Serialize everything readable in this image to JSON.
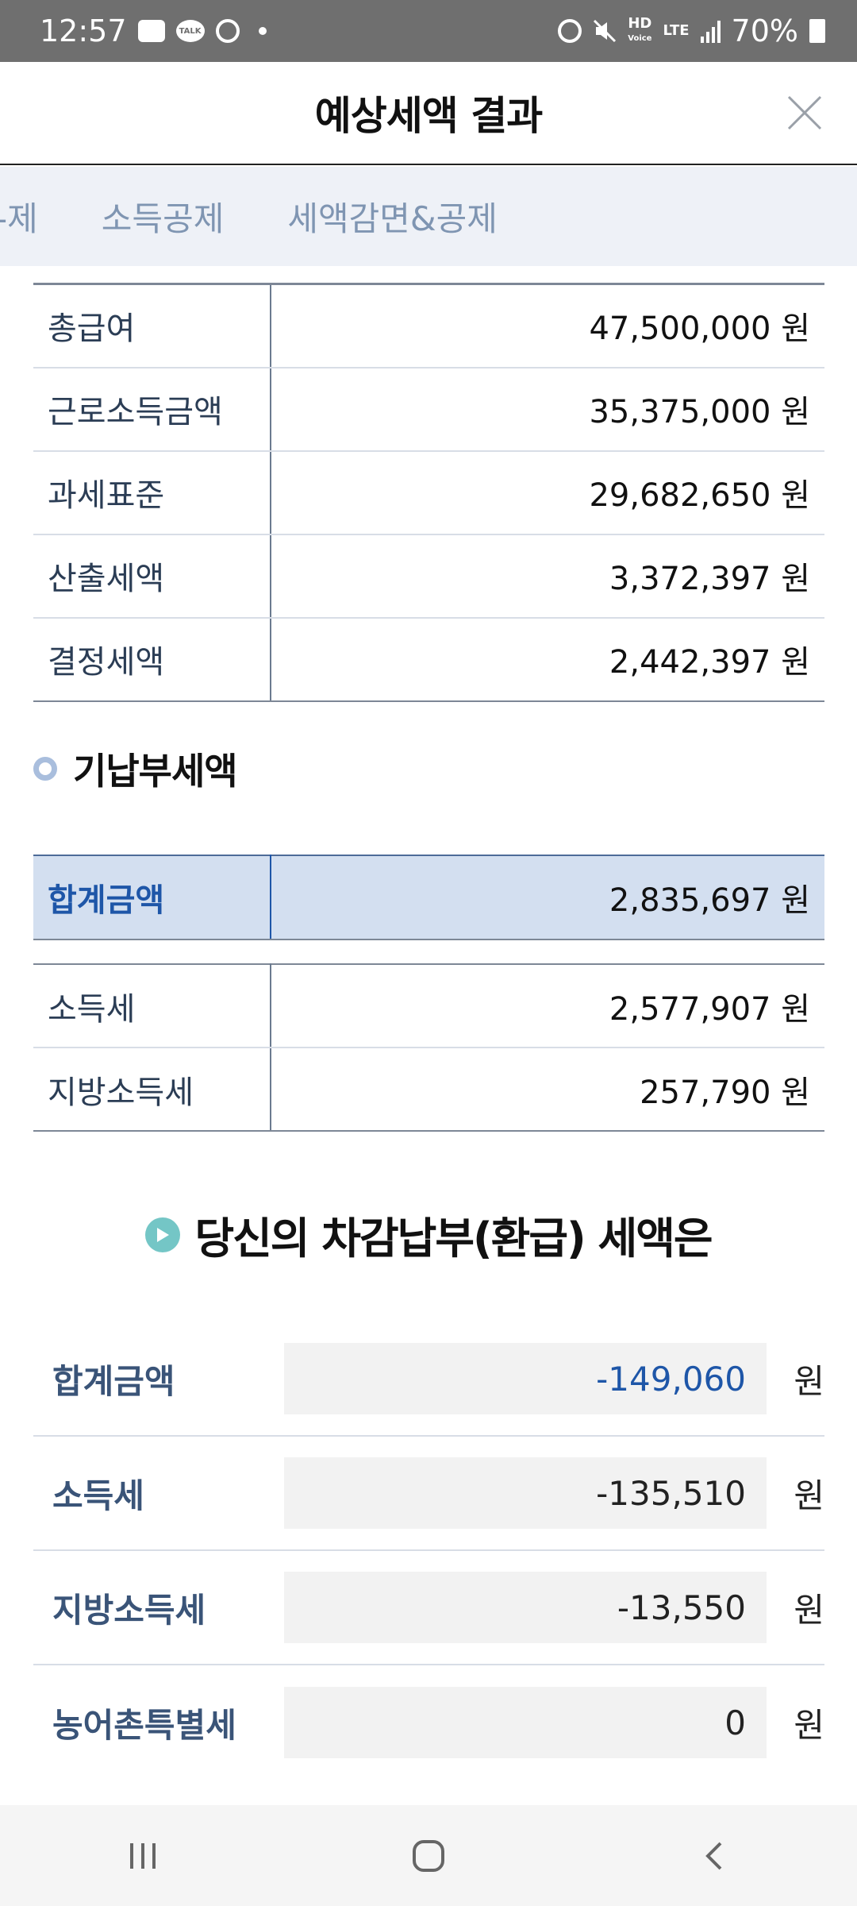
{
  "status_bar": {
    "time": "12:57",
    "talk_label": "TALK",
    "hd_label": "HD",
    "voice_label": "Voice",
    "lte_label": "LTE",
    "battery": "70%"
  },
  "header": {
    "title": "예상세액 결과"
  },
  "tabs": [
    {
      "label": "-제"
    },
    {
      "label": "소득공제"
    },
    {
      "label": "세액감면&공제"
    }
  ],
  "summary_table": [
    {
      "label": "총급여",
      "value": "47,500,000 원"
    },
    {
      "label": "근로소득금액",
      "value": "35,375,000 원"
    },
    {
      "label": "과세표준",
      "value": "29,682,650 원"
    },
    {
      "label": "산출세액",
      "value": "3,372,397 원"
    },
    {
      "label": "결정세액",
      "value": "2,442,397 원"
    }
  ],
  "prepaid": {
    "section_title": "기납부세액",
    "total": {
      "label": "합계금액",
      "value": "2,835,697 원"
    },
    "rows": [
      {
        "label": "소득세",
        "value": "2,577,907 원"
      },
      {
        "label": "지방소득세",
        "value": "257,790 원"
      }
    ]
  },
  "result": {
    "title": "당신의 차감납부(환급) 세액은",
    "unit": "원",
    "rows": [
      {
        "label": "합계금액",
        "value": "-149,060"
      },
      {
        "label": "소득세",
        "value": "-135,510"
      },
      {
        "label": "지방소득세",
        "value": "-13,550"
      },
      {
        "label": "농어촌특별세",
        "value": "0"
      }
    ]
  },
  "colors": {
    "accent_blue": "#1e56a8",
    "highlight_bg": "#d3dff0",
    "play_icon": "#74c6c6",
    "tab_bg": "#eef1f7"
  }
}
